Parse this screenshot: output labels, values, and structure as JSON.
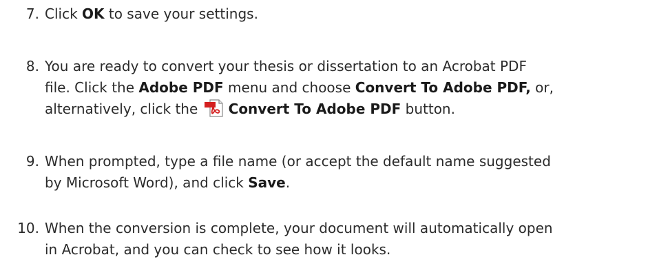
{
  "steps": [
    {
      "number": "7.",
      "pre": "Click ",
      "b1": "OK",
      "post": " to save your settings."
    },
    {
      "number": "8.",
      "line1": "You are ready to convert your thesis or dissertation to an Acrobat PDF",
      "l2_pre": "file. Click the ",
      "l2_b1": "Adobe PDF",
      "l2_mid": " menu and choose ",
      "l2_b2": "Convert To Adobe PDF,",
      "l2_post": " or,",
      "l3_pre": "alternatively, click the ",
      "l3_icon": "adobe-pdf-convert-icon",
      "l3_b": "Convert To Adobe PDF",
      "l3_post": " button."
    },
    {
      "number": "9.",
      "line1": "When prompted, type a file name (or accept the default name suggested",
      "l2_pre": "by Microsoft Word), and click ",
      "l2_b": "Save",
      "l2_post": "."
    },
    {
      "number": "10.",
      "line1": "When the conversion is complete, your document will automatically open",
      "line2": "in Acrobat, and you can check to see how it looks."
    }
  ],
  "colors": {
    "text": "#2b2b2b",
    "icon_red": "#d42020"
  }
}
